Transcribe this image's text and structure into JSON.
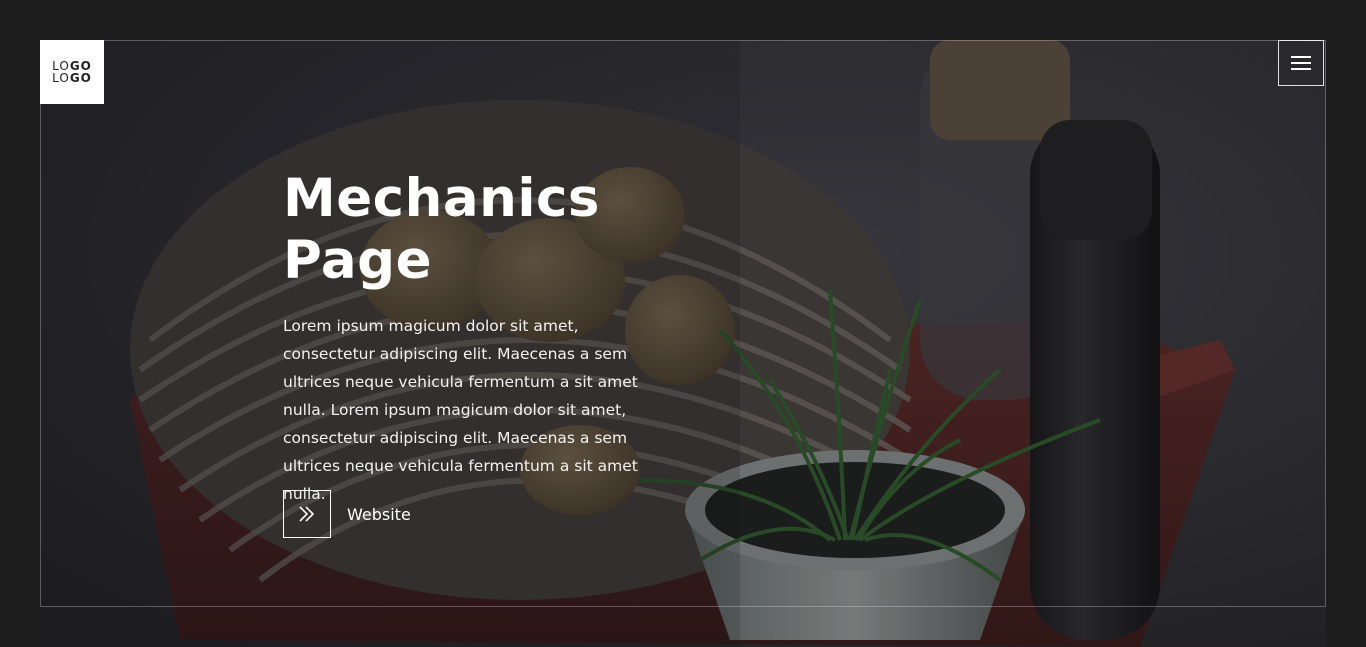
{
  "logo": {
    "line1_light": "LO",
    "line1_bold": "GO",
    "line2_light": "LO",
    "line2_bold": "GO"
  },
  "menu": {
    "icon": "hamburger-menu-icon"
  },
  "hero": {
    "title_line1": "Mechanics",
    "title_line2": "Page",
    "description": "Lorem ipsum magicum dolor sit amet, consectetur adipiscing elit. Maecenas a sem ultrices neque vehicula fermentum a sit amet nulla. Lorem ipsum magicum dolor sit amet, consectetur adipiscing elit. Maecenas a sem ultrices neque vehicula fermentum a sit amet nulla.",
    "cta_label": "Website",
    "cta_icon": "double-chevron-right-icon"
  },
  "colors": {
    "page_background": "#1d1d1e",
    "text": "#ffffff",
    "logo_background": "#ffffff"
  }
}
